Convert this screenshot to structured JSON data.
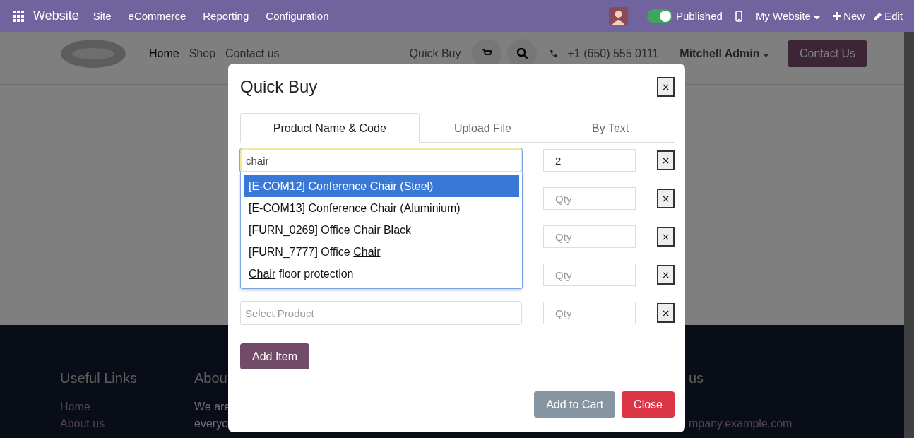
{
  "topbar": {
    "app": "Website",
    "menu": [
      "Site",
      "eCommerce",
      "Reporting",
      "Configuration"
    ],
    "published": {
      "label": "Published",
      "on": true
    },
    "website": "My Website",
    "new": "New",
    "edit": "Edit"
  },
  "site_header": {
    "nav": [
      {
        "label": "Home",
        "selected": true
      },
      {
        "label": "Shop",
        "selected": false
      },
      {
        "label": "Contact us",
        "selected": false
      }
    ],
    "quick_buy": "Quick Buy",
    "phone": "+1 (650) 555 0111",
    "user": "Mitchell Admin",
    "contact_button": "Contact Us"
  },
  "footer": {
    "columns": [
      {
        "heading": "Useful Links",
        "lines": [
          {
            "kind": "link",
            "text": "Home"
          },
          {
            "kind": "link",
            "text": "About us"
          }
        ]
      },
      {
        "heading": "Abou",
        "lines": [
          {
            "kind": "text",
            "text": "We are"
          },
          {
            "kind": "text",
            "text": "everyo"
          }
        ]
      },
      {
        "heading": "us",
        "lines": [
          {
            "kind": "link",
            "text": "mpany.example.com"
          }
        ]
      }
    ]
  },
  "dialog": {
    "title": "Quick Buy",
    "close_icon": "×",
    "tabs": [
      {
        "label": "Product Name & Code",
        "selected": true
      },
      {
        "label": "Upload File",
        "selected": false
      },
      {
        "label": "By Text",
        "selected": false
      }
    ],
    "rows": [
      {
        "product": {
          "value": "chair"
        },
        "qty": {
          "value": "2"
        },
        "remove": "×"
      },
      {
        "qty": {
          "placeholder": "Qty"
        },
        "remove": "×"
      },
      {
        "qty": {
          "placeholder": "Qty"
        },
        "remove": "×"
      },
      {
        "qty": {
          "placeholder": "Qty"
        },
        "remove": "×"
      },
      {
        "product": {
          "placeholder": "Select Product"
        },
        "qty": {
          "placeholder": "Qty"
        },
        "remove": "×"
      }
    ],
    "suggestions": [
      {
        "before": "[E-COM12] Conference ",
        "match": "Chair",
        "after": " (Steel)",
        "selected": true
      },
      {
        "before": "[E-COM13] Conference ",
        "match": "Chair",
        "after": " (Aluminium)",
        "selected": false
      },
      {
        "before": "[FURN_0269] Office ",
        "match": "Chair",
        "after": " Black",
        "selected": false
      },
      {
        "before": "[FURN_7777] Office ",
        "match": "Chair",
        "selected": false
      },
      {
        "match": "Chair",
        "after": " floor protection",
        "selected": false
      }
    ],
    "add_item": "Add Item",
    "add_to_cart": "Add to Cart",
    "close": "Close"
  }
}
